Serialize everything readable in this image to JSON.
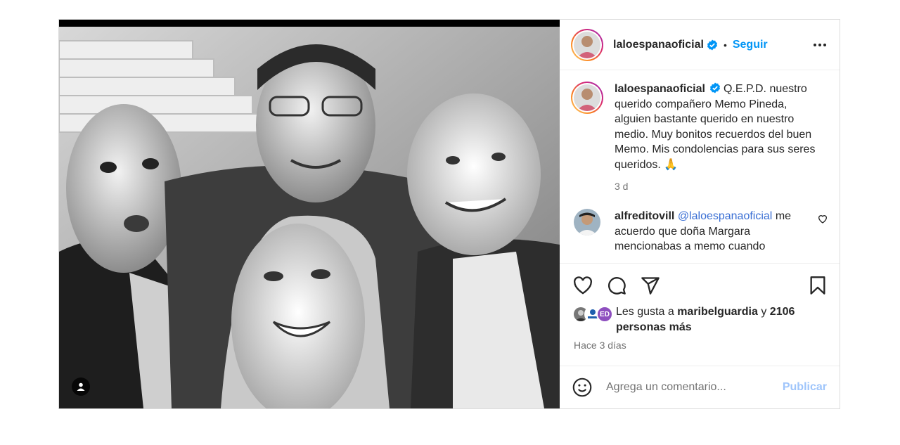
{
  "post": {
    "author": "laloespanaoficial",
    "separator": "•",
    "follow_label": "Seguir",
    "caption": {
      "username": "laloespanaoficial",
      "text": "Q.E.P.D. nuestro querido compañero Memo Pineda, alguien bastante querido en nuestro medio. Muy bonitos recuerdos del buen Memo. Mis condolencias para sus seres queridos. 🙏",
      "time": "3 d"
    },
    "comments": [
      {
        "username": "alfreditovill",
        "mention": "@laloespanaoficial",
        "text": "me acuerdo que doña Margara mencionabas a memo cuando"
      }
    ],
    "likes": {
      "prefix": "Les gusta a",
      "user": "maribelguardia",
      "connector": "y",
      "count_text": "2106 personas más",
      "avatar_badge": "ED"
    },
    "date": "Hace 3 días",
    "comment_placeholder": "Agrega un comentario...",
    "publish_label": "Publicar"
  },
  "icons": {
    "verified": "verified-badge-icon",
    "more": "more-options-icon",
    "like": "heart-icon",
    "comment": "comment-icon",
    "share": "share-icon",
    "save": "bookmark-icon",
    "emoji": "emoji-icon",
    "tag": "tagged-user-icon"
  },
  "colors": {
    "link": "#0095f6",
    "mention": "#3a6fd4",
    "publish_disabled": "#9fc5fb",
    "verified": "#0095f6"
  }
}
